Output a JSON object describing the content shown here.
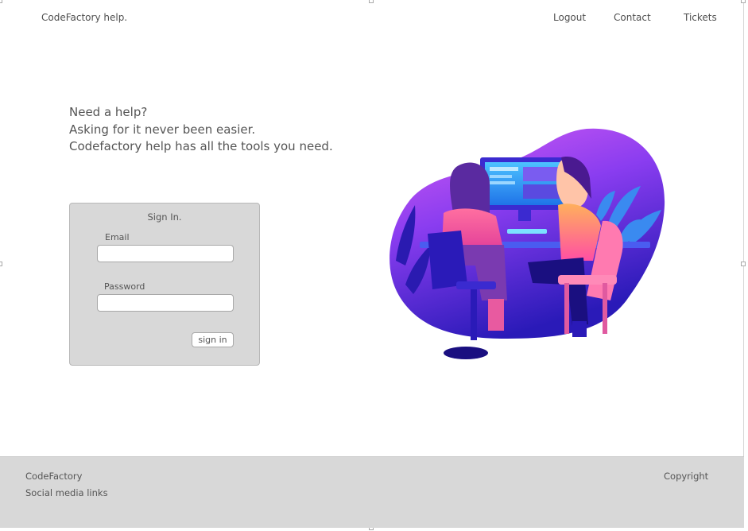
{
  "header": {
    "brand": "CodeFactory help.",
    "nav": {
      "logout": "Logout",
      "contact": "Contact",
      "tickets": "Tickets"
    }
  },
  "hero": {
    "line1": "Need a help?",
    "line2": "Asking for it never been easier.",
    "line3": "Codefactory help has all the tools you need."
  },
  "signin": {
    "title": "Sign In.",
    "email_label": "Email",
    "email_value": "",
    "password_label": "Password",
    "password_value": "",
    "button_label": "sign in"
  },
  "footer": {
    "company": "CodeFactory",
    "social": "Social media links",
    "copyright": "Copyright"
  },
  "colors": {
    "footer_bg": "#d8d8d8",
    "panel_bg": "#d8d8d8",
    "illustration_purple": "#7b3cf2",
    "illustration_magenta": "#d64cf0"
  }
}
